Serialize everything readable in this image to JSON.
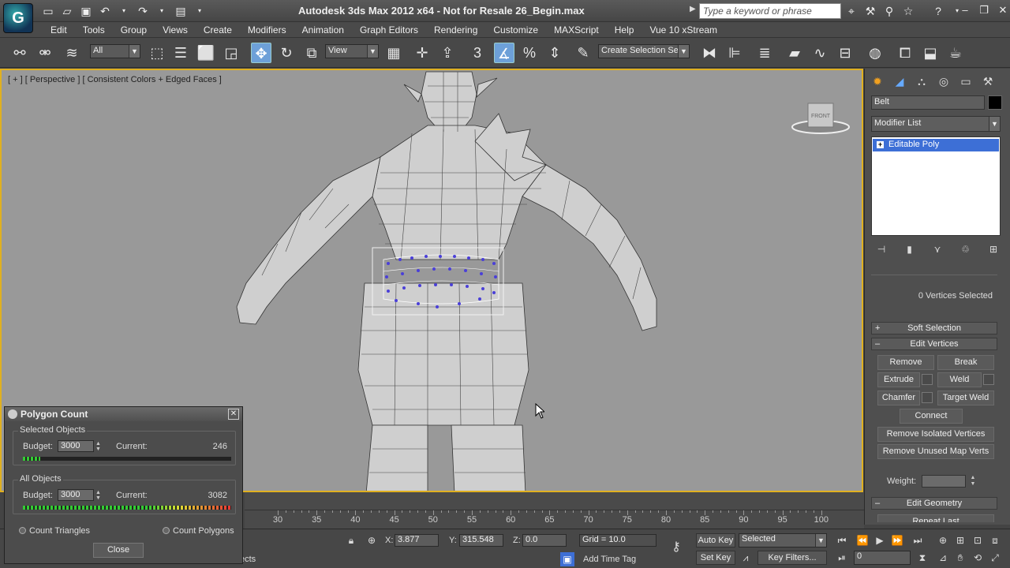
{
  "window": {
    "title": "Autodesk 3ds Max  2012 x64  - Not for Resale   26_Begin.max"
  },
  "search": {
    "placeholder": "Type a keyword or phrase"
  },
  "menu": [
    "Edit",
    "Tools",
    "Group",
    "Views",
    "Create",
    "Modifiers",
    "Animation",
    "Graph Editors",
    "Rendering",
    "Customize",
    "MAXScript",
    "Help",
    "Vue 10 xStream"
  ],
  "toolbar": {
    "filter_value": "All",
    "coord_value": "View",
    "snap_label": "3",
    "named_selection": "Create Selection Set"
  },
  "viewport": {
    "label": "[ + ] [ Perspective ] [ Consistent Colors + Edged Faces ]",
    "viewcube_face": "FRONT"
  },
  "command_panel": {
    "object_name": "Belt",
    "modifier_list": "Modifier List",
    "stack_item": "Editable Poly",
    "selection_info": "0 Vertices Selected",
    "soft_selection": "Soft Selection",
    "edit_vertices": "Edit Vertices",
    "edit_geometry": "Edit Geometry",
    "repeat_last": "Repeat Last",
    "buttons": {
      "remove": "Remove",
      "break": "Break",
      "extrude": "Extrude",
      "weld": "Weld",
      "chamfer": "Chamfer",
      "target_weld": "Target Weld",
      "connect": "Connect",
      "remove_isolated": "Remove Isolated Vertices",
      "remove_unused": "Remove Unused Map Verts"
    },
    "weight_label": "Weight:"
  },
  "polygon_count": {
    "title": "Polygon Count",
    "selected": {
      "label": "Selected Objects",
      "budget_label": "Budget:",
      "budget": "3000",
      "current_label": "Current:",
      "current": "246",
      "fill_fraction": 0.082
    },
    "all": {
      "label": "All Objects",
      "budget_label": "Budget:",
      "budget": "3000",
      "current_label": "Current:",
      "current": "3082",
      "fill_fraction": 1.0
    },
    "count_triangles": "Count Triangles",
    "count_polygons": "Count Polygons",
    "close": "Close"
  },
  "timeline": {
    "ticks": [
      "30",
      "35",
      "40",
      "45",
      "50",
      "55",
      "60",
      "65",
      "70",
      "75",
      "80",
      "85",
      "90",
      "95",
      "100"
    ]
  },
  "status": {
    "x_label": "X:",
    "x": "3.877",
    "y_label": "Y:",
    "y": "315.548",
    "z_label": "Z:",
    "z": "0.0",
    "grid": "Grid = 10.0",
    "auto_key": "Auto Key",
    "selected": "Selected",
    "set_key": "Set Key",
    "key_filters": "Key Filters...",
    "add_time_tag": "Add Time Tag",
    "frame": "0",
    "prompt_fragment": "ects"
  }
}
